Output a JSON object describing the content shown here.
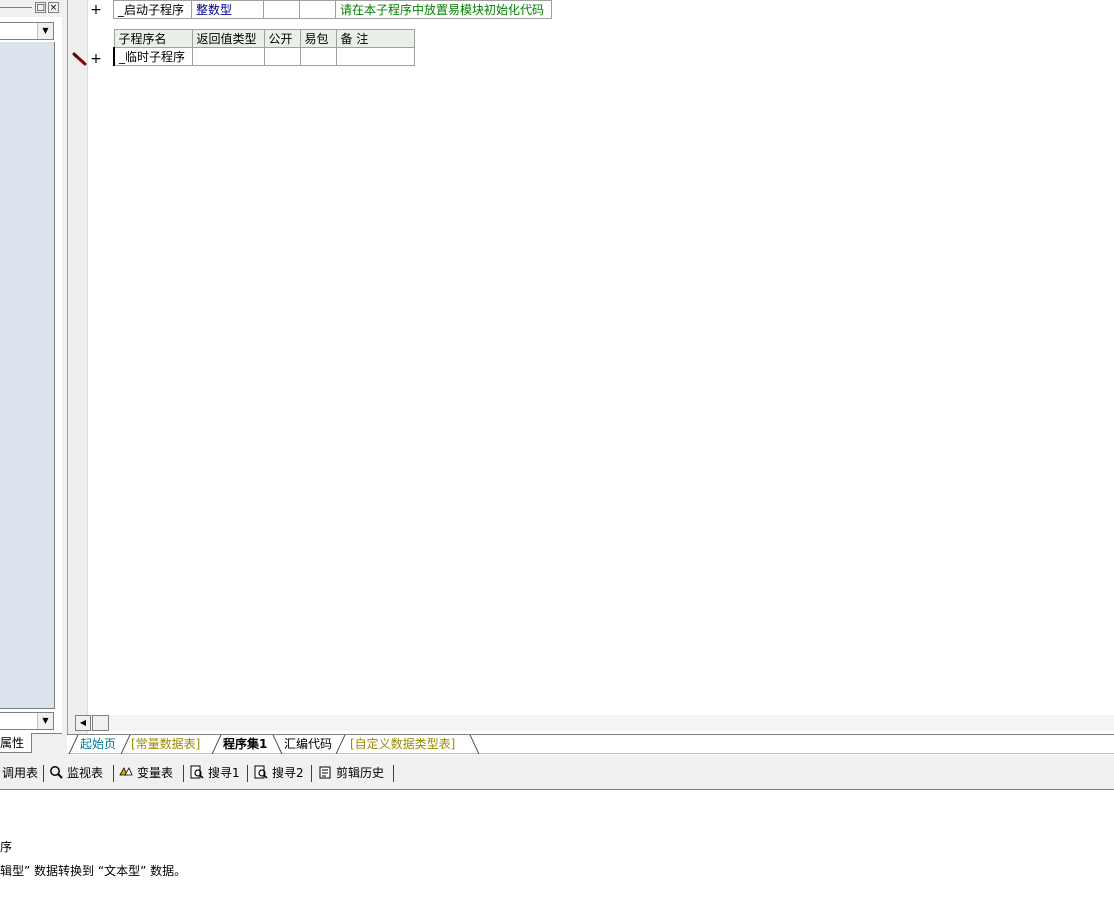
{
  "left_panel": {
    "restore_glyph": "□",
    "close_glyph": "×",
    "dropdown_arrow": "▼",
    "property_tab": "属性"
  },
  "editor": {
    "startup_row": {
      "name": "_启动子程序",
      "return_type": "整数型",
      "public": "",
      "package": "",
      "note": "请在本子程序中放置易模块初始化代码"
    },
    "sub_table": {
      "headers": [
        "子程序名",
        "返回值类型",
        "公开",
        "易包",
        "备 注"
      ],
      "row": {
        "name": "_临时子程序",
        "return_type": "",
        "public": "",
        "package": "",
        "note": ""
      }
    },
    "expand_glyph": "+",
    "scroll_left_glyph": "◀"
  },
  "editor_tabs": [
    {
      "label": "起始页",
      "color": "#007a99",
      "bold": false
    },
    {
      "label": "[常量数据表]",
      "color": "#9a8a00",
      "bold": false
    },
    {
      "label": "程序集1",
      "color": "#000000",
      "bold": true
    },
    {
      "label": "汇编代码",
      "color": "#000000",
      "bold": false
    },
    {
      "label": "[自定义数据类型表]",
      "color": "#9a8a00",
      "bold": false
    }
  ],
  "tool_tabs": [
    {
      "label": "调用表",
      "icon": "none"
    },
    {
      "label": "监视表",
      "icon": "magnifier-icon"
    },
    {
      "label": "变量表",
      "icon": "variables-icon"
    },
    {
      "label": "搜寻1",
      "icon": "search-doc-icon"
    },
    {
      "label": "搜寻2",
      "icon": "search-doc-icon"
    },
    {
      "label": "剪辑历史",
      "icon": "clipboard-icon"
    }
  ],
  "output": {
    "line1": "序",
    "line2": "辑型” 数据转换到 “文本型” 数据。"
  },
  "colors": {
    "property_area": "#dbe3ec",
    "table_header": "#e8f0e8",
    "type_text": "#00008b",
    "note_text": "#008000"
  }
}
